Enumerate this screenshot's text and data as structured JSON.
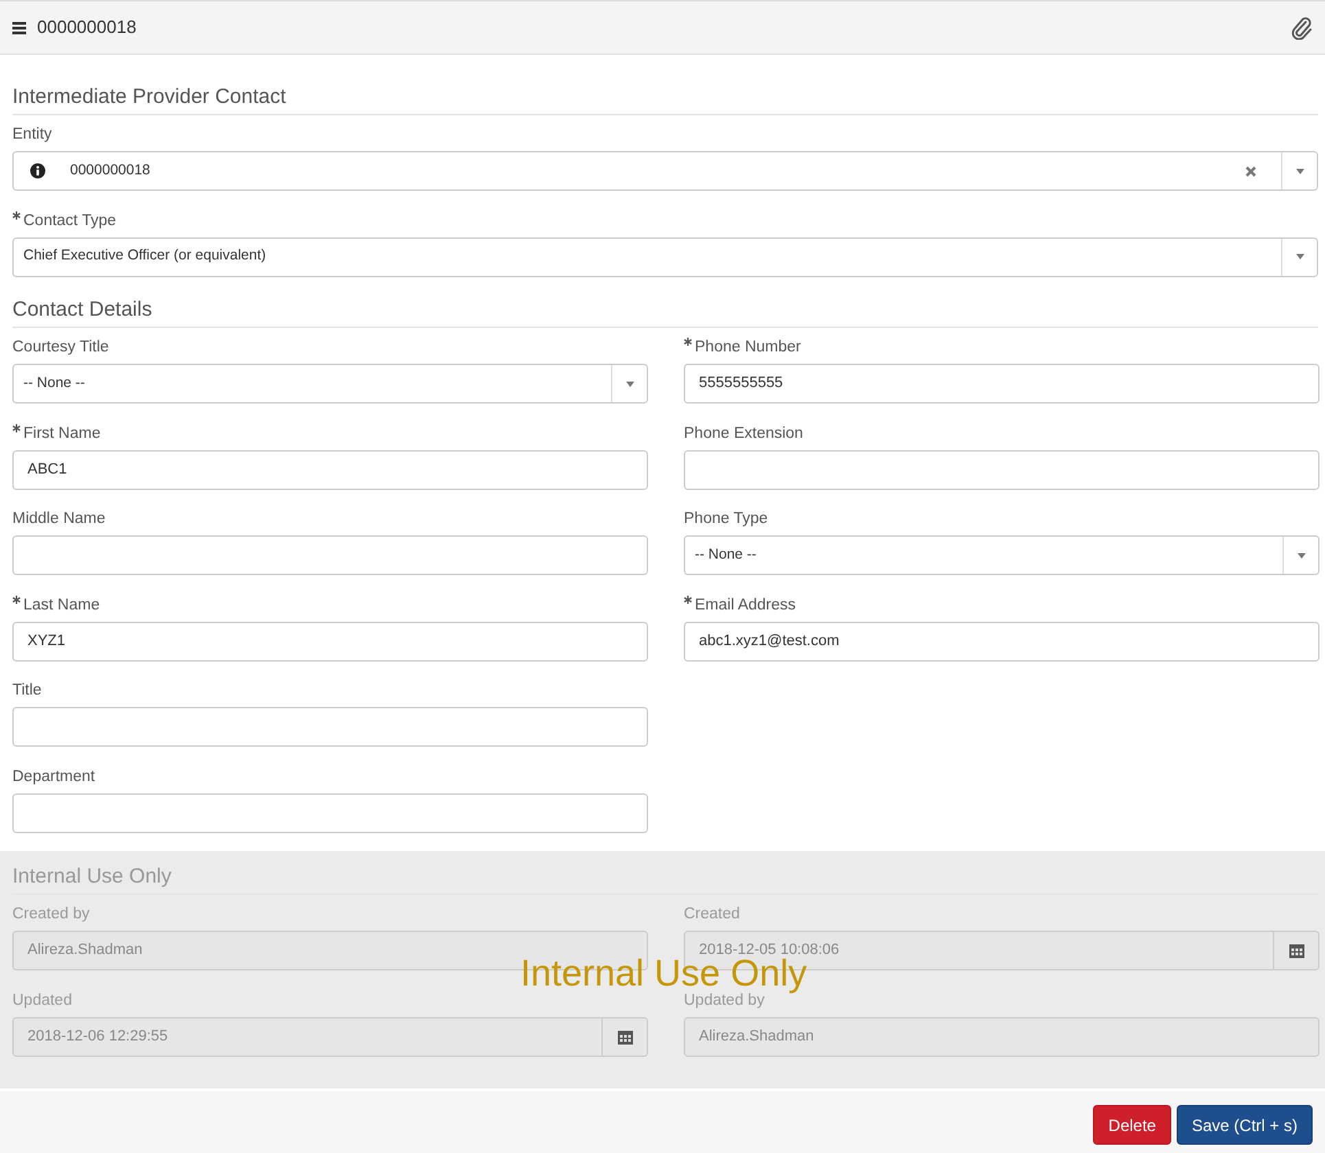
{
  "header": {
    "record": "0000000018"
  },
  "sections": [
    {
      "title": "Intermediate Provider Contact",
      "readonly": false,
      "rows": [
        {
          "label": "Entity",
          "kind": "reference",
          "mandatory": false,
          "value": "0000000018"
        },
        {
          "label": "Contact Type",
          "kind": "select",
          "mandatory": true,
          "value": "Chief Executive Officer (or equivalent)"
        }
      ]
    },
    {
      "title": "Contact Details",
      "readonly": false,
      "left_column": [
        {
          "label": "Courtesy Title",
          "kind": "select",
          "mandatory": false,
          "value": "-- None --"
        },
        {
          "label": "First Name",
          "kind": "text",
          "mandatory": true,
          "value": "ABC1"
        },
        {
          "label": "Middle Name",
          "kind": "text",
          "mandatory": false
        },
        {
          "label": "Last Name",
          "kind": "text",
          "mandatory": true,
          "value": "XYZ1"
        },
        {
          "label": "Title",
          "kind": "text",
          "mandatory": false
        },
        {
          "label": "Department",
          "kind": "text",
          "mandatory": false
        }
      ],
      "right_column": [
        {
          "label": "Phone Number",
          "kind": "text",
          "mandatory": true,
          "value": "5555555555"
        },
        {
          "label": "Phone Extension",
          "kind": "text",
          "mandatory": false
        },
        {
          "label": "Phone Type",
          "kind": "select",
          "mandatory": false,
          "value": "-- None --"
        },
        {
          "label": "Email Address",
          "kind": "text",
          "mandatory": true,
          "value": "abc1.xyz1@test.com"
        }
      ]
    },
    {
      "title": "Internal Use Only",
      "readonly": true,
      "overlay": "Internal Use Only",
      "left_column": [
        {
          "label": "Created by",
          "kind": "text",
          "mandatory": false,
          "value": "Alireza.Shadman"
        },
        {
          "label": "Updated",
          "kind": "date",
          "mandatory": false,
          "value": "2018-12-06 12:29:55"
        }
      ],
      "right_column": [
        {
          "label": "Created",
          "kind": "date",
          "mandatory": false,
          "value": "2018-12-05 10:08:06"
        },
        {
          "label": "Updated by",
          "kind": "text",
          "mandatory": false,
          "value": "Alireza.Shadman"
        }
      ]
    }
  ],
  "buttons": [
    {
      "label": "Delete",
      "kind": "danger"
    },
    {
      "label": "Save (Ctrl + s)",
      "kind": "primary"
    }
  ]
}
